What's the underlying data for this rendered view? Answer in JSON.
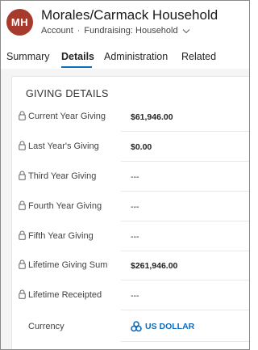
{
  "header": {
    "avatar_initials": "MH",
    "avatar_color": "#a63a2c",
    "title": "Morales/Carmack Household",
    "entity": "Account",
    "separator": "·",
    "form_name": "Fundraising: Household"
  },
  "tabs": [
    {
      "label": "Summary",
      "active": false
    },
    {
      "label": "Details",
      "active": true
    },
    {
      "label": "Administration",
      "active": false
    },
    {
      "label": "Related",
      "active": false
    }
  ],
  "section": {
    "title": "GIVING DETAILS",
    "fields": [
      {
        "label": "Current Year Giving",
        "value": "$61,946.00",
        "locked": true
      },
      {
        "label": "Last Year's Giving",
        "value": "$0.00",
        "locked": true
      },
      {
        "label": "Third Year Giving",
        "value": "---",
        "locked": true
      },
      {
        "label": "Fourth Year Giving",
        "value": "---",
        "locked": true
      },
      {
        "label": "Fifth Year Giving",
        "value": "---",
        "locked": true
      },
      {
        "label": "Lifetime Giving Sum",
        "value": "$261,946.00",
        "locked": true
      },
      {
        "label": "Lifetime Receipted",
        "value": "---",
        "locked": true
      },
      {
        "label": "Currency",
        "value": "US DOLLAR",
        "locked": false,
        "icon": "currency-icon"
      }
    ]
  },
  "colors": {
    "accent": "#0f6cbd",
    "tab_underline": "#0f6cbd"
  }
}
